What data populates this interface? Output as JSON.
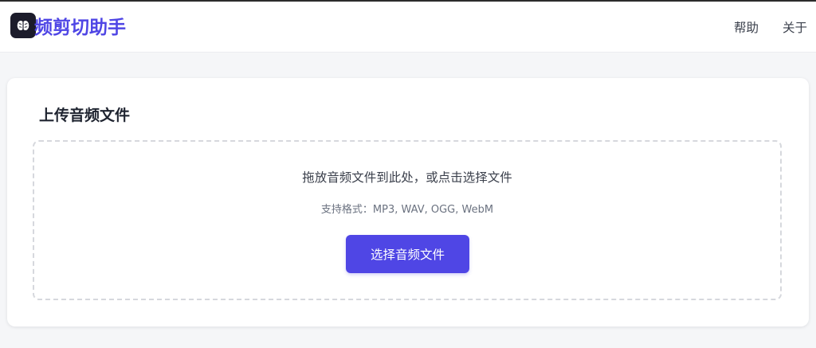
{
  "colors": {
    "accent": "#4f46e5",
    "header_bg": "#ffffff",
    "page_bg": "#f5f6f8",
    "logo_bg": "#1c1c2b"
  },
  "header": {
    "logo_icon": "brain-icon",
    "app_title": "频剪切助手",
    "nav": {
      "help": "帮助",
      "about": "关于"
    }
  },
  "upload": {
    "title": "上传音频文件",
    "drop_text": "拖放音频文件到此处，或点击选择文件",
    "formats": "支持格式：MP3, WAV, OGG, WebM",
    "button_label": "选择音频文件"
  }
}
